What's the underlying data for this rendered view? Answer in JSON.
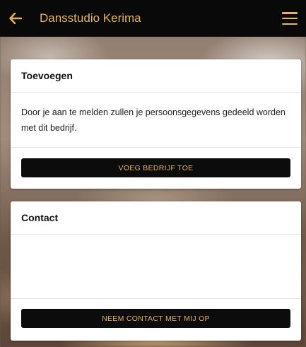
{
  "appbar": {
    "title": "Dansstudio Kerima",
    "back_icon": "arrow-left-icon",
    "menu_icon": "hamburger-menu-icon",
    "accent_color": "#e8b25a",
    "background_color": "#090909"
  },
  "add_card": {
    "title": "Toevoegen",
    "body": "Door je aan te melden zullen je persoonsgegevens gedeeld worden met dit bedrijf.",
    "button_label": "VOEG BEDRIJF TOE"
  },
  "contact_card": {
    "title": "Contact",
    "body": "",
    "button_label": "NEEM CONTACT MET MIJ OP"
  }
}
